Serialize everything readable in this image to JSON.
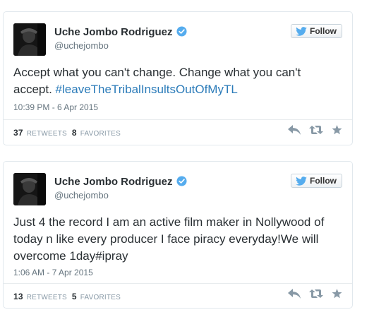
{
  "tweets": [
    {
      "name": "Uche Jombo Rodriguez",
      "handle": "@uchejombo",
      "follow_label": "Follow",
      "text": "Accept what you can't change. Change what you can't accept. ",
      "hashtag": "#leaveTheTribalInsultsOutOfMyTL",
      "timestamp": "10:39 PM - 6 Apr 2015",
      "retweets_count": "37",
      "retweets_label": "RETWEETS",
      "favorites_count": "8",
      "favorites_label": "FAVORITES"
    },
    {
      "name": "Uche Jombo Rodriguez",
      "handle": "@uchejombo",
      "follow_label": "Follow",
      "text": "Just 4 the record I am an active film maker in Nollywood of today n like every producer I face piracy everyday!We will overcome 1day#ipray",
      "hashtag": "",
      "timestamp": "1:06 AM - 7 Apr 2015",
      "retweets_count": "13",
      "retweets_label": "RETWEETS",
      "favorites_count": "5",
      "favorites_label": "FAVORITES"
    }
  ],
  "icons": {
    "verified": "verified-badge-icon",
    "bird": "twitter-bird-icon",
    "reply": "reply-icon",
    "retweet": "retweet-icon",
    "favorite": "star-icon"
  },
  "colors": {
    "accent": "#2b7bb9",
    "verified": "#55acee",
    "text": "#292f33",
    "muted": "#66757f",
    "action": "#8899a6"
  }
}
